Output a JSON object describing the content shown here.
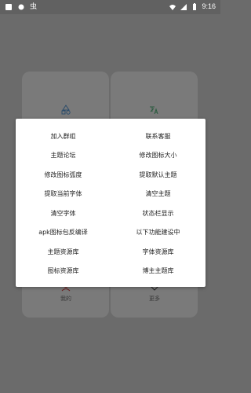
{
  "status_bar": {
    "time": "9:16",
    "app_glyph": "虫",
    "icons": [
      "notification-icon",
      "android-icon",
      "wifi-icon",
      "signal-icon",
      "battery-icon"
    ]
  },
  "background": {
    "labels": {
      "bottom_left": "我的",
      "bottom_right": "更多"
    },
    "icons": [
      "shapes-icon",
      "translate-icon",
      "user-icon",
      "more-icon"
    ]
  },
  "dialog": {
    "items": [
      "加入群组",
      "联系客服",
      "主题论坛",
      "修改图标大小",
      "修改图标弧度",
      "提取默认主题",
      "提取当前字体",
      "清空主题",
      "清空字体",
      "状态栏显示",
      "apk图标包反编译",
      "以下功能建设中",
      "主题资源库",
      "字体资源库",
      "图标资源库",
      "博主主题库"
    ]
  },
  "colors": {
    "overlay": "#6b6b6b",
    "card": "#7a7a7a",
    "dialog": "#ffffff",
    "text": "#222222"
  }
}
